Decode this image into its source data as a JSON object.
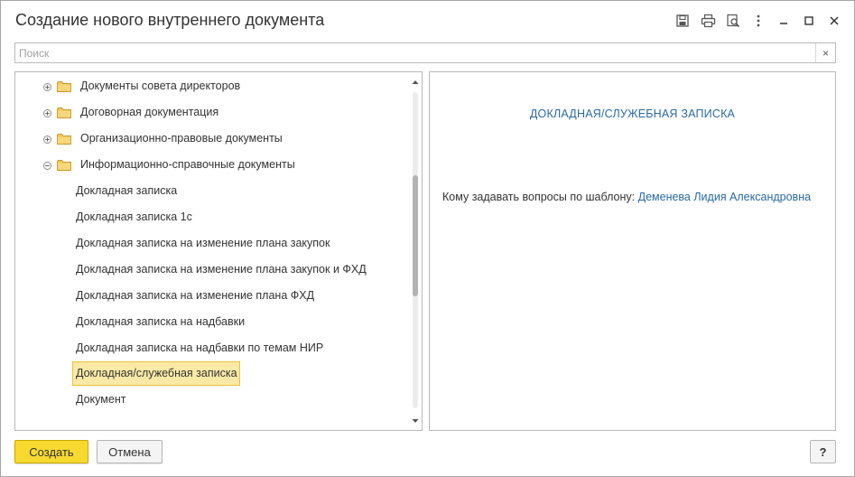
{
  "window": {
    "title": "Создание нового внутреннего документа"
  },
  "titlebar_icons": [
    "save-icon",
    "print-icon",
    "preview-icon",
    "more-icon",
    "minimize-icon",
    "maximize-icon",
    "close-icon"
  ],
  "search": {
    "placeholder": "Поиск",
    "value": "",
    "clear_label": "×"
  },
  "tree": {
    "folders": [
      {
        "label": "Документы совета директоров",
        "expanded": false
      },
      {
        "label": "Договорная документация",
        "expanded": false
      },
      {
        "label": "Организационно-правовые документы",
        "expanded": false
      },
      {
        "label": "Информационно-справочные документы",
        "expanded": true
      }
    ],
    "items": [
      {
        "label": "Докладная записка",
        "selected": false
      },
      {
        "label": "Докладная записка 1с",
        "selected": false
      },
      {
        "label": "Докладная записка на изменение плана закупок",
        "selected": false
      },
      {
        "label": "Докладная записка на изменение плана закупок и ФХД",
        "selected": false
      },
      {
        "label": "Докладная записка на изменение плана ФХД",
        "selected": false
      },
      {
        "label": "Докладная записка на надбавки",
        "selected": false
      },
      {
        "label": "Докладная записка на надбавки по темам НИР",
        "selected": false
      },
      {
        "label": "Докладная/служебная записка",
        "selected": true
      },
      {
        "label": "Документ",
        "selected": false
      }
    ]
  },
  "preview": {
    "title": "ДОКЛАДНАЯ/СЛУЖЕБНАЯ ЗАПИСКА",
    "contact_label": "Кому задавать вопросы по шаблону:",
    "contact_name": "Деменева Лидия Александровна"
  },
  "buttons": {
    "create": "Создать",
    "cancel": "Отмена",
    "help": "?"
  },
  "colors": {
    "accent_yellow": "#f8d92f",
    "selection_fill": "#fbe9a6",
    "selection_border": "#e9c23c",
    "link_blue": "#2a6aa0",
    "folder_yellow": "#f2c75c"
  }
}
